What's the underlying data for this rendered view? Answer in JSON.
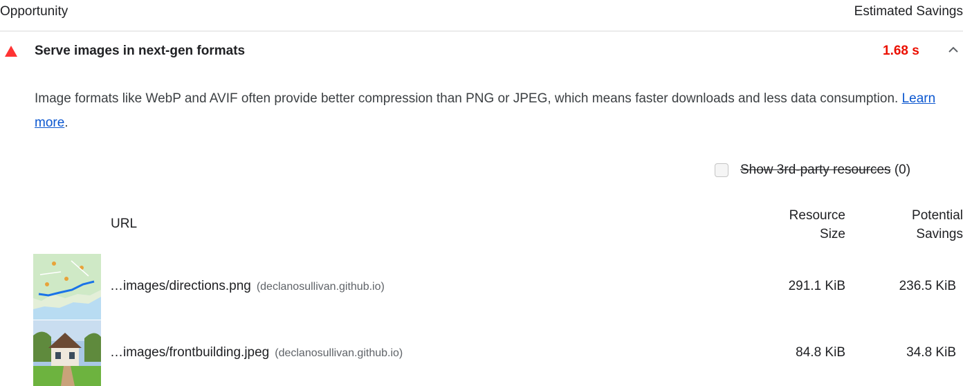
{
  "header": {
    "opportunity_label": "Opportunity",
    "savings_label": "Estimated Savings"
  },
  "audit": {
    "title": "Serve images in next-gen formats",
    "savings": "1.68 s",
    "status_color": "#eb0f00",
    "icon": "warning-triangle-icon",
    "description": "Image formats like WebP and AVIF often provide better compression than PNG or JPEG, which means faster downloads and less data consumption.",
    "learn_more": "Learn more",
    "learn_more_suffix": "."
  },
  "filter": {
    "label": "Show 3rd-party resources",
    "count": "(0)",
    "checked": false
  },
  "table": {
    "col_url": "URL",
    "col_size_line1": "Resource",
    "col_size_line2": "Size",
    "col_savings_line1": "Potential",
    "col_savings_line2": "Savings",
    "rows": [
      {
        "url": "…images/directions.png",
        "host": "(declanosullivan.github.io)",
        "size": "291.1 KiB",
        "savings": "236.5 KiB",
        "thumb": "map-thumbnail"
      },
      {
        "url": "…images/frontbuilding.jpeg",
        "host": "(declanosullivan.github.io)",
        "size": "84.8 KiB",
        "savings": "34.8 KiB",
        "thumb": "house-thumbnail"
      }
    ]
  }
}
